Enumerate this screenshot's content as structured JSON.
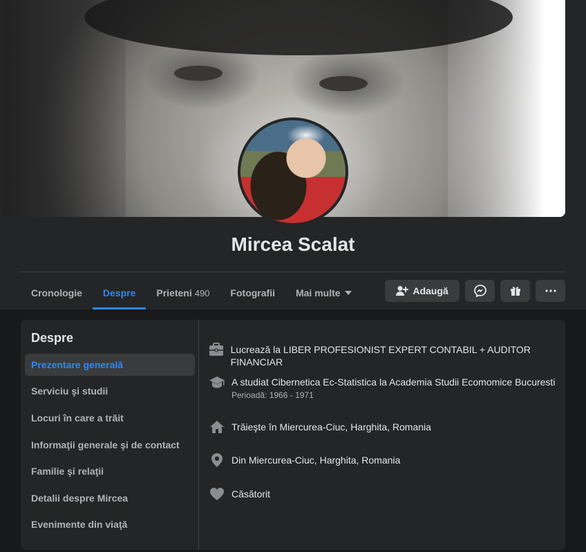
{
  "profile": {
    "name": "Mircea Scalat"
  },
  "tabs": [
    {
      "label": "Cronologie"
    },
    {
      "label": "Despre"
    },
    {
      "label": "Prieteni",
      "count": "490"
    },
    {
      "label": "Fotografii"
    },
    {
      "label": "Mai multe"
    }
  ],
  "actions": {
    "add_label": "Adaugă"
  },
  "about": {
    "title": "Despre",
    "menu": [
      "Prezentare generală",
      "Serviciu şi studii",
      "Locuri în care a trăit",
      "Informaţii generale şi de contact",
      "Familie şi relaţii",
      "Detalii despre Mircea",
      "Evenimente din viaţă"
    ],
    "overview": {
      "work": "Lucrează la LIBER PROFESIONIST EXPERT CONTABIL + AUDITOR FINANCIAR",
      "education": "A studiat Cibernetica Ec-Statistica la Academia Studii Ecomomice Bucuresti",
      "education_period": "Perioadă: 1966 - 1971",
      "lives": "Trăieşte în Miercurea-Ciuc, Harghita, Romania",
      "from": "Din Miercurea-Ciuc, Harghita, Romania",
      "relationship": "Căsătorit"
    }
  },
  "colors": {
    "accent": "#2d88ff",
    "surface": "#242526",
    "background": "#18191a",
    "button": "#3a3b3c"
  }
}
